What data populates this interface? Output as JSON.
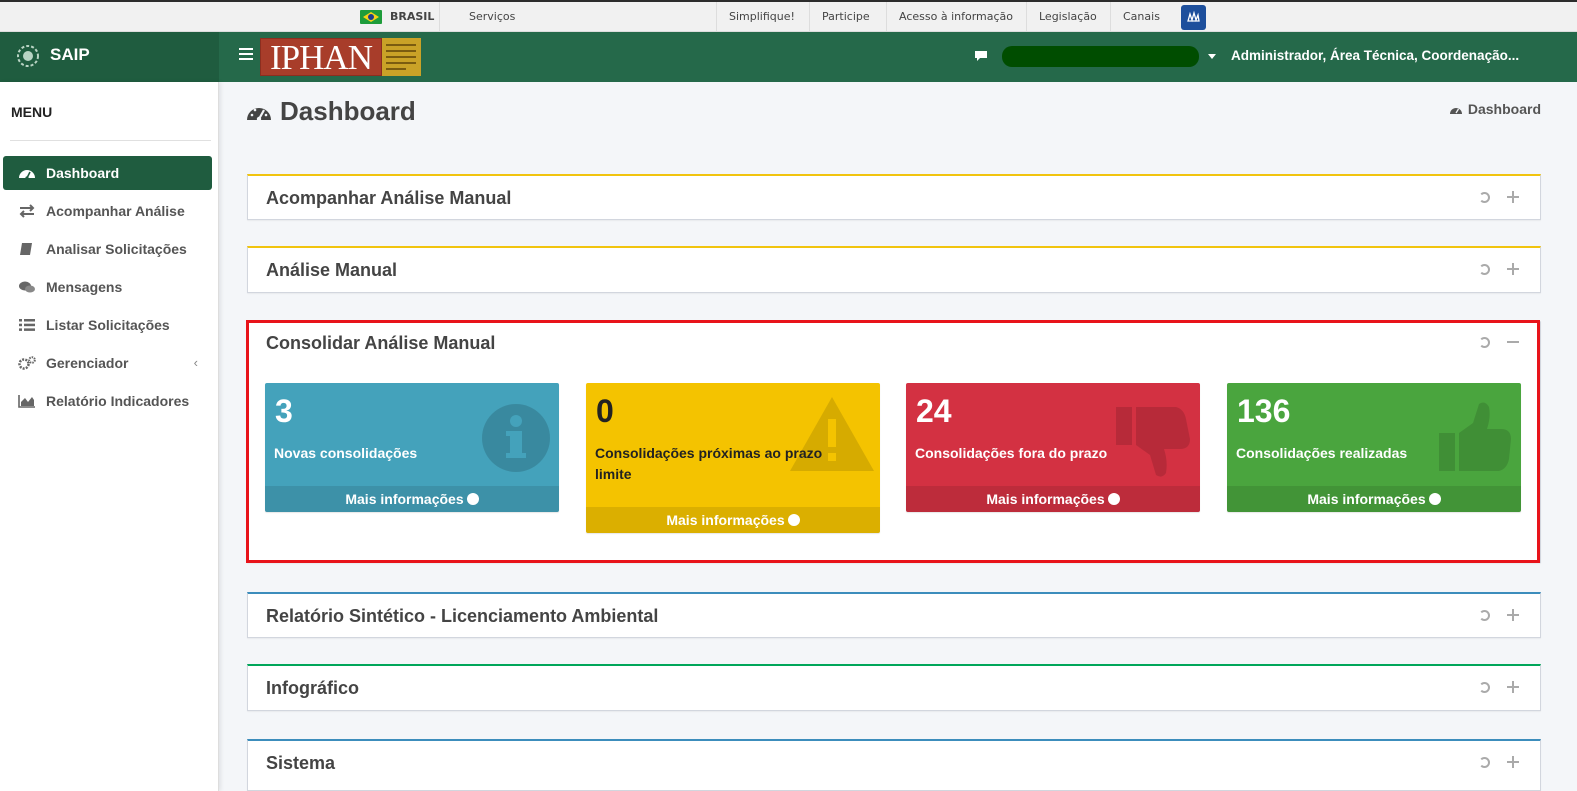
{
  "govbar": {
    "country": "BRASIL",
    "services": "Serviços",
    "links": [
      "Simplifique!",
      "Participe",
      "Acesso à informação",
      "Legislação",
      "Canais"
    ]
  },
  "header": {
    "app_name": "SAIP",
    "logo_text": "IPHAN",
    "user": "Administrador, Área Técnica, Coordenação..."
  },
  "sidebar": {
    "title": "MENU",
    "items": [
      {
        "label": "Dashboard",
        "icon": "dashboard-icon",
        "active": true
      },
      {
        "label": "Acompanhar Análise",
        "icon": "exchange-icon"
      },
      {
        "label": "Analisar Solicitações",
        "icon": "book-icon"
      },
      {
        "label": "Mensagens",
        "icon": "comments-icon"
      },
      {
        "label": "Listar Solicitações",
        "icon": "list-icon"
      },
      {
        "label": "Gerenciador",
        "icon": "cogs-icon",
        "chevron": "‹"
      },
      {
        "label": "Relatório Indicadores",
        "icon": "area-chart-icon"
      }
    ]
  },
  "page": {
    "title": "Dashboard",
    "breadcrumb": "Dashboard"
  },
  "boxes": [
    {
      "title": "Acompanhar Análise Manual",
      "color": "#f1c40f",
      "collapsed": true
    },
    {
      "title": "Análise Manual",
      "color": "#f1c40f",
      "collapsed": true
    },
    {
      "title": "Consolidar Análise Manual",
      "color": "#ffffff",
      "collapsed": false
    },
    {
      "title": "Relatório Sintético - Licenciamento Ambiental",
      "color": "#3c8dbc",
      "collapsed": true
    },
    {
      "title": "Infográfico",
      "color": "#00a65a",
      "collapsed": true
    },
    {
      "title": "Sistema",
      "color": "#3c8dbc",
      "collapsed": true
    }
  ],
  "kpis": [
    {
      "value": "3",
      "label": "Novas consolidações",
      "footer": "Mais informações",
      "color": "#44a2bb",
      "icon": "info-circle-icon"
    },
    {
      "value": "0",
      "label": "Consolidações próximas ao prazo limite",
      "footer": "Mais informações",
      "color": "#f4c300",
      "icon": "warning-icon"
    },
    {
      "value": "24",
      "label": "Consolidações fora do prazo",
      "footer": "Mais informações",
      "color": "#d33142",
      "icon": "thumbs-down-icon"
    },
    {
      "value": "136",
      "label": "Consolidações realizadas",
      "footer": "Mais informações",
      "color": "#4aa53e",
      "icon": "thumbs-up-icon"
    }
  ]
}
